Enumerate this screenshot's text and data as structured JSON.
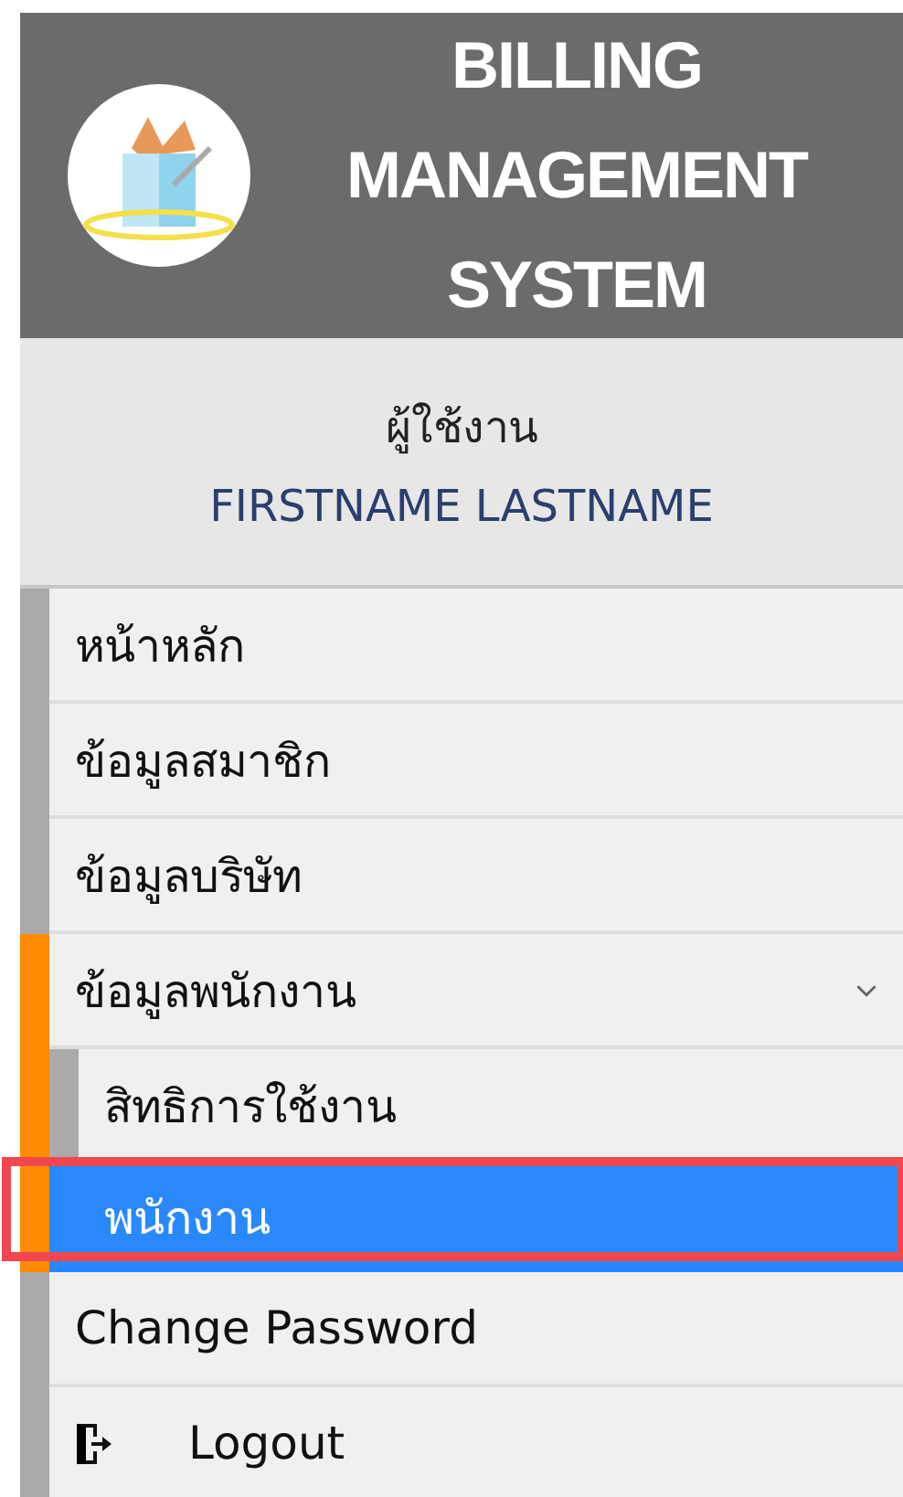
{
  "header": {
    "title_lines": [
      "BILLING",
      "MANAGEMENT",
      "SYSTEM"
    ]
  },
  "user": {
    "label": "ผู้ใช้งาน",
    "name": "FIRSTNAME LASTNAME"
  },
  "menu": [
    {
      "kind": "link",
      "label": "หน้าหลัก",
      "selected": false
    },
    {
      "kind": "link",
      "label": "ข้อมูลสมาชิก",
      "selected": false
    },
    {
      "kind": "link",
      "label": "ข้อมูลบริษัท",
      "selected": false
    },
    {
      "kind": "group",
      "label": "ข้อมูลพนักงาน",
      "selected": false,
      "expanded": true,
      "children": [
        {
          "label": "สิทธิการใช้งาน",
          "selected": false,
          "annotated": false
        },
        {
          "label": "พนักงาน",
          "selected": true,
          "annotated": true
        }
      ]
    },
    {
      "kind": "link",
      "label": "Change Password",
      "selected": false
    },
    {
      "kind": "logout",
      "label": "Logout",
      "selected": false
    }
  ]
}
